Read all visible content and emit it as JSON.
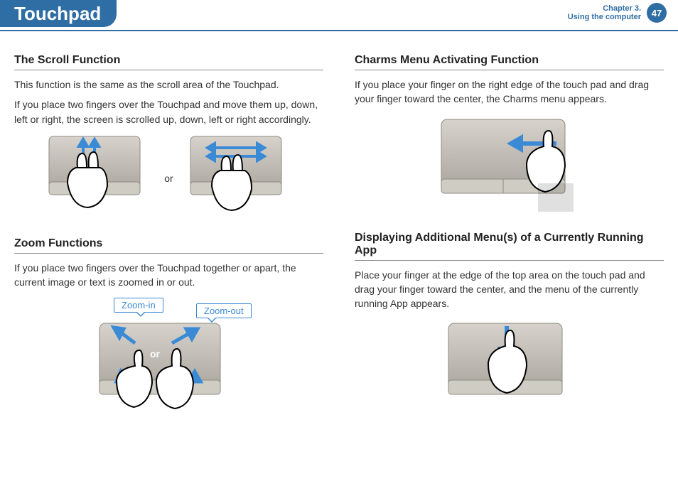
{
  "header": {
    "title": "Touchpad",
    "chapter_line1": "Chapter 3.",
    "chapter_line2": "Using the computer",
    "page_number": "47"
  },
  "left": {
    "scroll": {
      "title": "The Scroll Function",
      "p1": "This function is the same as the scroll area of the Touchpad.",
      "p2": "If you place two fingers over the Touchpad and move them up, down, left or right, the screen is scrolled up, down, left or right accordingly.",
      "or": "or"
    },
    "zoom": {
      "title": "Zoom Functions",
      "p1": "If you place two fingers over the Touchpad together or apart, the current image or text is zoomed in or out.",
      "label_in": "Zoom-in",
      "label_out": "Zoom-out",
      "or_overlay": "or"
    }
  },
  "right": {
    "charms": {
      "title": "Charms Menu Activating Function",
      "p1": "If you place your finger on the right edge of the touch pad and drag your finger toward the center, the Charms menu appears."
    },
    "appmenu": {
      "title": "Displaying Additional Menu(s) of a Currently Running App",
      "p1": "Place your finger at the edge of the top area on the touch pad and drag your finger toward the center, and the menu of the currently running App appears."
    }
  }
}
